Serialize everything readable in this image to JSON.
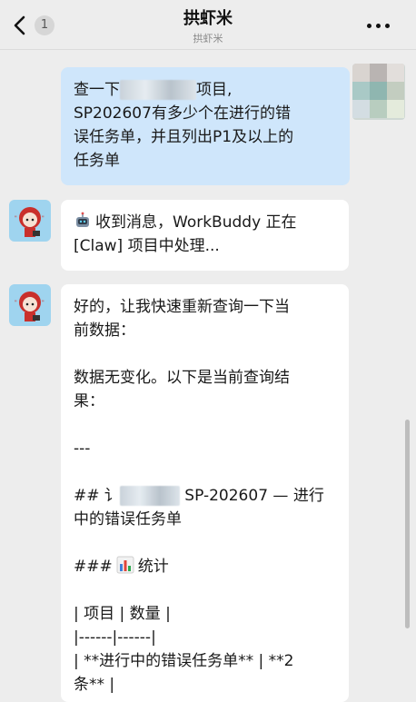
{
  "header": {
    "back_badge": "1",
    "title": "拱虾米",
    "subtitle": "拱虾米"
  },
  "messages": {
    "user": {
      "line1_prefix": "查一下",
      "line1_suffix": "项目,",
      "line2": "SP202607有多少个在进行的错",
      "line3": "误任务单，并且列出P1及以上的",
      "line4": "任务单"
    },
    "bot1": {
      "line1": "收到消息，WorkBuddy 正在",
      "line2": "[Claw] 项目中处理..."
    },
    "bot2": {
      "line1": "好的，让我快速重新查询一下当",
      "line2": "前数据：",
      "line3": "数据无变化。以下是当前查询结",
      "line4": "果：",
      "line5": "---",
      "line6_prefix": "## 讠",
      "line6_suffix": " SP-202607 — 进行",
      "line7": "中的错误任务单",
      "line8_prefix": "###",
      "line8_suffix": "统计",
      "line9": "| 项目 | 数量 |",
      "line10": "|------|------|",
      "line11": "| **进行中的错误任务单** | **2",
      "line12": "条** |"
    }
  },
  "colors": {
    "background": "#ededed",
    "user_bubble": "#cfe6fb",
    "bot_bubble": "#ffffff"
  },
  "icons": {
    "back": "chevron-left-icon",
    "more": "more-dots-icon",
    "robot": "robot-icon",
    "chart": "bar-chart-icon"
  }
}
